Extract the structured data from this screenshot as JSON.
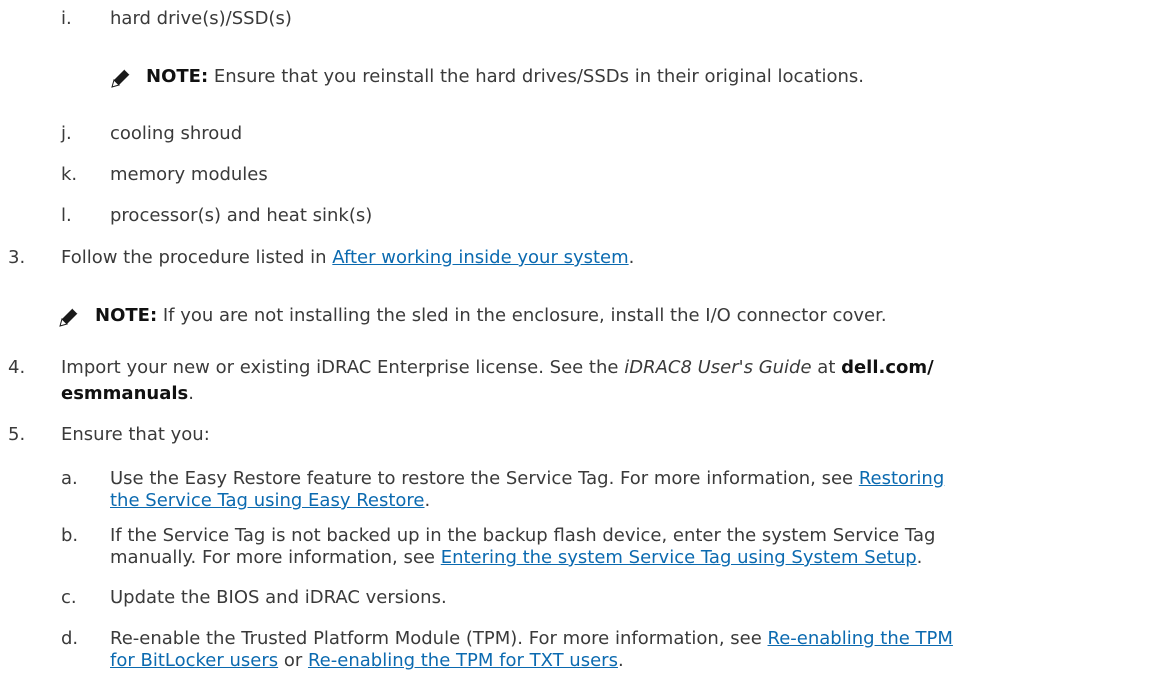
{
  "items": {
    "i": {
      "marker": "i.",
      "text": "hard drive(s)/SSD(s)"
    },
    "note1": {
      "label": "NOTE:",
      "text": " Ensure that you reinstall the hard drives/SSDs in their original locations."
    },
    "j": {
      "marker": "j.",
      "text": "cooling shroud"
    },
    "k": {
      "marker": "k.",
      "text": "memory modules"
    },
    "l": {
      "marker": "l.",
      "text": "processor(s) and heat sink(s)"
    },
    "s3": {
      "marker": "3.",
      "pre": "Follow the procedure listed in ",
      "link": "After working inside your system",
      "post": "."
    },
    "note2": {
      "label": "NOTE:",
      "text": " If you are not installing the sled in the enclosure, install the I/O connector cover."
    },
    "s4": {
      "marker": "4.",
      "pre": "Import your new or existing iDRAC Enterprise license. See the ",
      "guide": "iDRAC8 User's Guide",
      "mid": " at ",
      "url1": "dell.com/",
      "url2": "esmmanuals",
      "post": "."
    },
    "s5": {
      "marker": "5.",
      "text": "Ensure that you:"
    },
    "a": {
      "marker": "a.",
      "pre": "Use the Easy Restore feature to restore the Service Tag. For more information, see ",
      "link1": "Restoring",
      "link2": "the Service Tag using Easy Restore",
      "post": "."
    },
    "b": {
      "marker": "b.",
      "line1": "If the Service Tag is not backed up in the backup flash device, enter the system Service Tag",
      "pre": "manually. For more information, see ",
      "link": "Entering the system Service Tag using System Setup",
      "post": "."
    },
    "c": {
      "marker": "c.",
      "text": "Update the BIOS and iDRAC versions."
    },
    "d": {
      "marker": "d.",
      "pre": "Re-enable the Trusted Platform Module (TPM). For more information, see ",
      "link1": "Re-enabling the TPM",
      "link2": "for BitLocker users",
      "mid": " or ",
      "link3": "Re-enabling the TPM for TXT users",
      "post": "."
    }
  },
  "icons": {
    "note": "pencil-icon"
  }
}
